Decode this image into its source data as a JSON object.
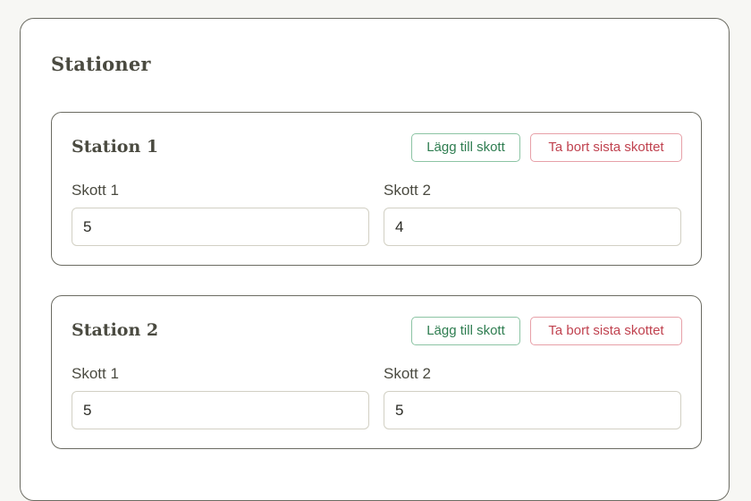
{
  "panel": {
    "title": "Stationer"
  },
  "stations": [
    {
      "title": "Station 1",
      "add_label": "Lägg till skott",
      "remove_label": "Ta bort sista skottet",
      "shots": [
        {
          "label": "Skott 1",
          "value": "5"
        },
        {
          "label": "Skott 2",
          "value": "4"
        }
      ]
    },
    {
      "title": "Station 2",
      "add_label": "Lägg till skott",
      "remove_label": "Ta bort sista skottet",
      "shots": [
        {
          "label": "Skott 1",
          "value": "5"
        },
        {
          "label": "Skott 2",
          "value": "5"
        }
      ]
    }
  ],
  "colors": {
    "add_accent": "#2e7d50",
    "remove_accent": "#c0424f",
    "border": "#6b6b62"
  }
}
